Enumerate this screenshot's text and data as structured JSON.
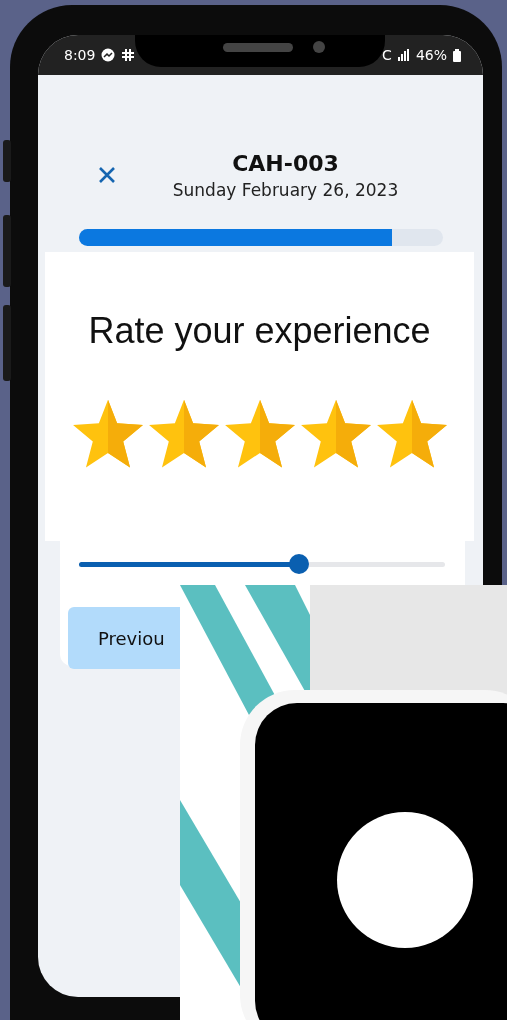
{
  "status_bar": {
    "time": "8:09",
    "carrier_fragment": "C",
    "battery": "46%"
  },
  "header": {
    "title": "CAH-003",
    "date": "Sunday February 26, 2023"
  },
  "progress": {
    "level": 0.86
  },
  "question": {
    "title": "Rate your experience",
    "stars": 5
  },
  "slider": {
    "level": 0.6
  },
  "buttons": [
    {
      "label": "Previou"
    }
  ]
}
